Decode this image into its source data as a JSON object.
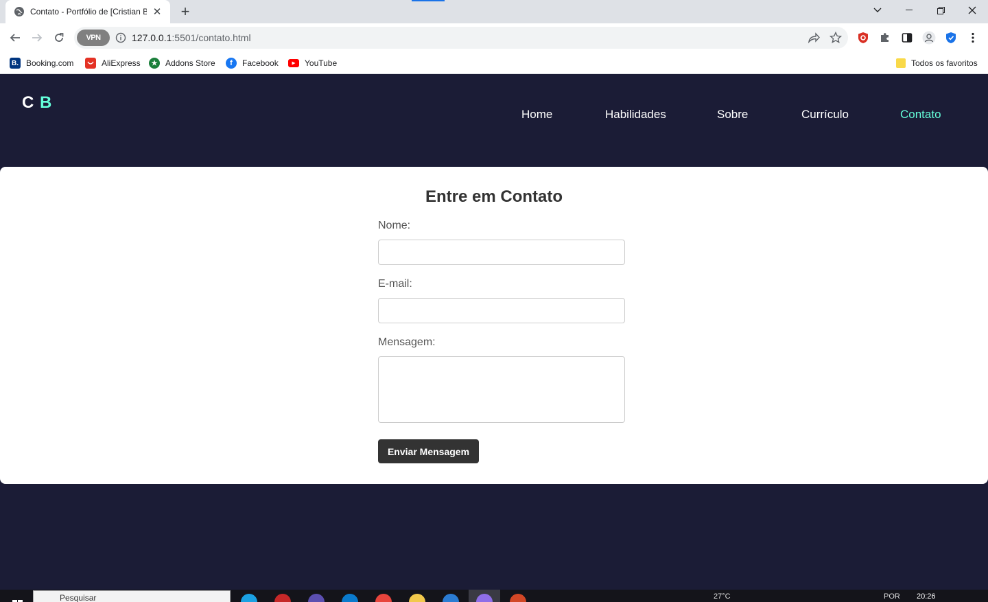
{
  "browser": {
    "tab_title": "Contato - Portfólio de [Cristian B",
    "tab_close": "✕",
    "new_tab": "+",
    "url_host": "127.0.0.1",
    "url_path": ":5501/contato.html",
    "vpn_label": "VPN",
    "bookmarks": [
      {
        "label": "Booking.com",
        "icon": "booking-icon",
        "color": "#003580"
      },
      {
        "label": "AliExpress",
        "icon": "aliexpress-icon",
        "color": "#e43225"
      },
      {
        "label": "Addons Store",
        "icon": "addons-store-icon",
        "color": "#1b7f3b"
      },
      {
        "label": "Facebook",
        "icon": "facebook-icon",
        "color": "#1877f2"
      },
      {
        "label": "YouTube",
        "icon": "youtube-icon",
        "color": "#ff0000"
      }
    ],
    "all_bookmarks": "Todos os favoritos"
  },
  "site": {
    "logo_first": "C",
    "logo_second": "B",
    "nav": [
      "Home",
      "Habilidades",
      "Sobre",
      "Currículo",
      "Contato"
    ],
    "active_nav": "Contato",
    "accent_color": "#64ffda",
    "background_color": "#1b1c36"
  },
  "form": {
    "title": "Entre em Contato",
    "name_label": "Nome:",
    "name_value": "",
    "email_label": "E-mail:",
    "email_value": "",
    "message_label": "Mensagem:",
    "message_value": "",
    "submit_label": "Enviar Mensagem"
  },
  "taskbar": {
    "search_placeholder": "Pesquisar",
    "time": "20:26",
    "weather": "27°C",
    "language": "POR"
  }
}
